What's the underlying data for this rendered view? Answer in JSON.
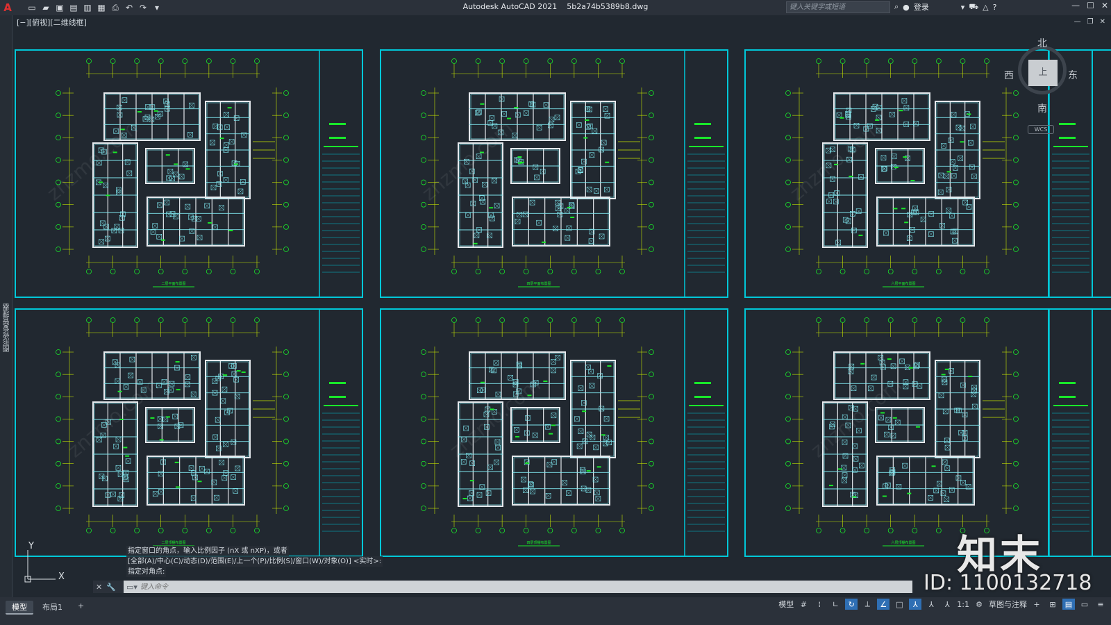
{
  "titlebar": {
    "app_title": "Autodesk AutoCAD 2021",
    "file_name": "5b2a74b5389b8.dwg",
    "search_placeholder": "键入关键字或短语",
    "login_label": "登录"
  },
  "viewport": {
    "label": "[−][俯视][二维线框]"
  },
  "left_palette": {
    "label": "图形修复管理器"
  },
  "viewcube": {
    "north": "北",
    "south": "南",
    "east": "东",
    "west": "西",
    "face": "上",
    "wcs": "WCS"
  },
  "ucs": {
    "x": "X",
    "y": "Y"
  },
  "sheets": [
    {
      "caption": "二层平面布置图"
    },
    {
      "caption": "四层平面布置图"
    },
    {
      "caption": "六层平面布置图"
    },
    {
      "caption": "二层顶棚布置图"
    },
    {
      "caption": "四层顶棚布置图"
    },
    {
      "caption": "六层顶棚布置图"
    }
  ],
  "command": {
    "history": [
      "指定窗口的角点，输入比例因子 (nX 或 nXP)，或者",
      "[全部(A)/中心(C)/动态(D)/范围(E)/上一个(P)/比例(S)/窗口(W)/对象(O)] <实时>:",
      "指定对角点:"
    ],
    "placeholder": "键入命令"
  },
  "watermark": {
    "logo": "知末",
    "id": "ID: 1100132718",
    "site": "znzmo.com"
  },
  "tabs": [
    {
      "label": "模型",
      "active": true
    },
    {
      "label": "布局1",
      "active": false
    },
    {
      "label": "+",
      "active": false
    }
  ],
  "statusbar": {
    "model_label": "模型",
    "scale": "1:1",
    "workspace": "草图与注释"
  },
  "colors": {
    "background": "#212830",
    "frame": "#00c8d8",
    "plan": "#7fe6ee",
    "walls": "#e6eaee",
    "accent": "#19e82a",
    "axis": "#c8e600"
  }
}
